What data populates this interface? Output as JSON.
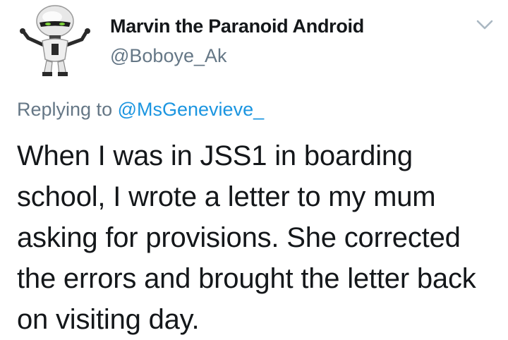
{
  "tweet": {
    "avatar_icon": "robot-avatar-icon",
    "display_name": "Marvin the Paranoid Android",
    "handle": "@Boboye_Ak",
    "menu_icon": "chevron-down-icon",
    "reply_prefix": "Replying to",
    "reply_mention": "@MsGenevieve_",
    "text": "When I was in JSS1 in boarding school, I wrote a letter to my mum asking for provisions. She corrected the errors and brought the letter back on visiting day."
  },
  "colors": {
    "text_primary": "#14171a",
    "text_secondary": "#657786",
    "link": "#1b95e0",
    "caret": "#aab8c2"
  }
}
